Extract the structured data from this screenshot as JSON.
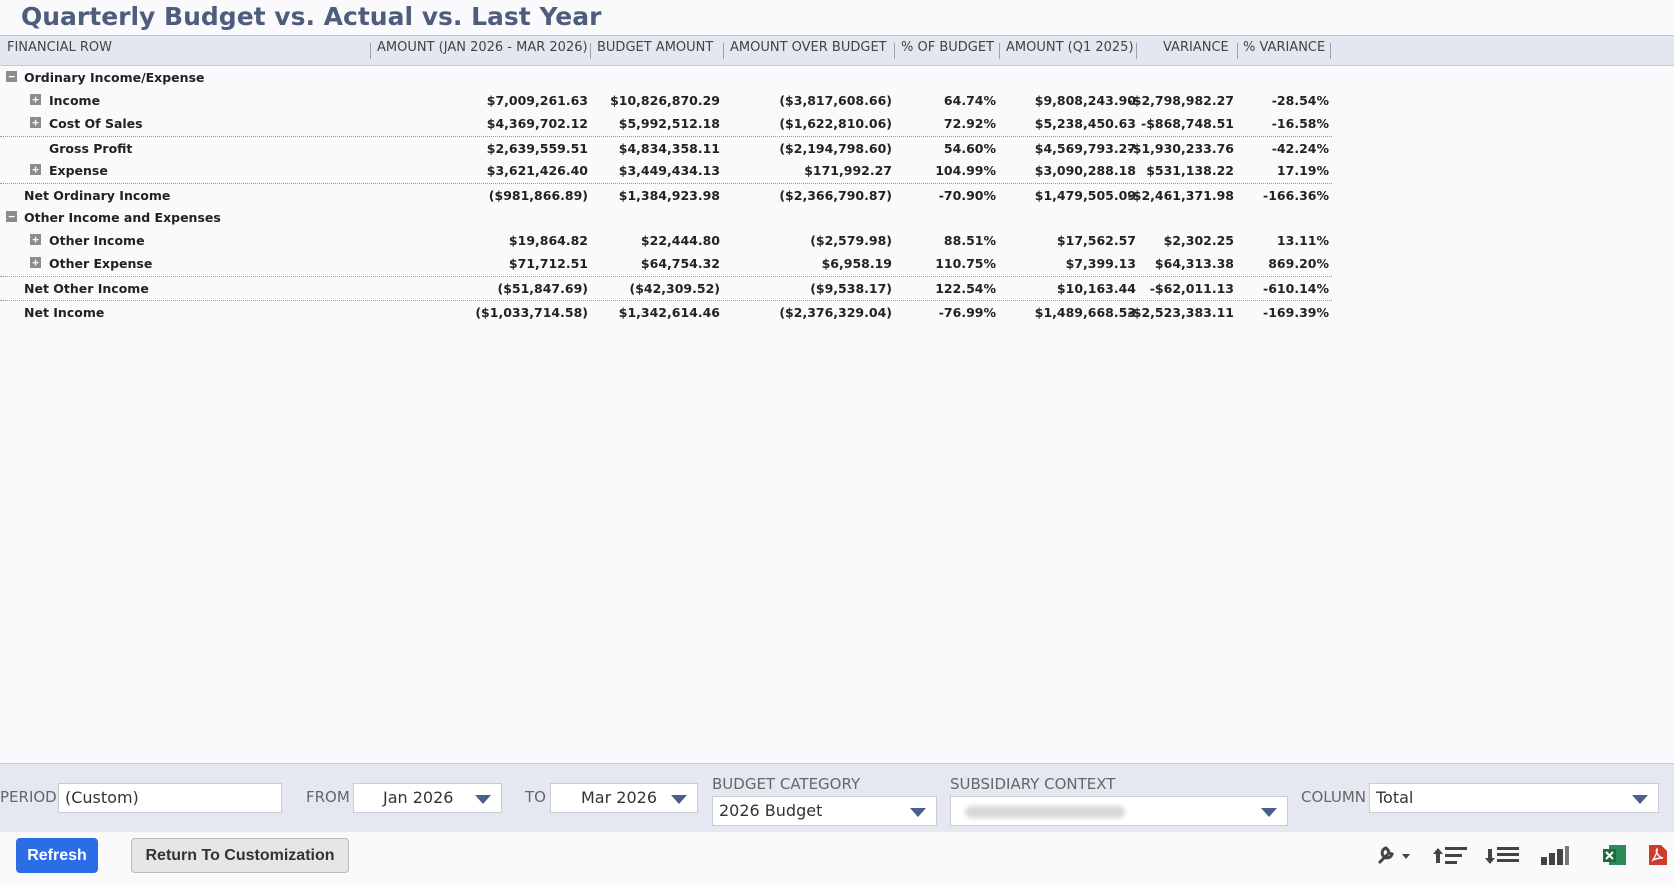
{
  "report": {
    "title": "Quarterly Budget vs. Actual vs. Last Year"
  },
  "columns": [
    "FINANCIAL ROW",
    "AMOUNT (JAN 2026 - MAR 2026)",
    "BUDGET AMOUNT",
    "AMOUNT OVER BUDGET",
    "% OF BUDGET",
    "AMOUNT (Q1 2025)",
    "VARIANCE",
    "% VARIANCE"
  ],
  "rows": [
    {
      "label": "Ordinary Income/Expense",
      "toggle": "minus",
      "values": [
        "",
        "",
        "",
        "",
        "",
        "",
        ""
      ]
    },
    {
      "label": "Income",
      "toggle": "plus",
      "values": [
        "$7,009,261.63",
        "$10,826,870.29",
        "($3,817,608.66)",
        "64.74%",
        "$9,808,243.90",
        "-$2,798,982.27",
        "-28.54%"
      ]
    },
    {
      "label": "Cost Of Sales",
      "toggle": "plus",
      "values": [
        "$4,369,702.12",
        "$5,992,512.18",
        "($1,622,810.06)",
        "72.92%",
        "$5,238,450.63",
        "-$868,748.51",
        "-16.58%"
      ]
    },
    {
      "label": "Gross Profit",
      "toggle": "",
      "values": [
        "$2,639,559.51",
        "$4,834,358.11",
        "($2,194,798.60)",
        "54.60%",
        "$4,569,793.27",
        "-$1,930,233.76",
        "-42.24%"
      ]
    },
    {
      "label": "Expense",
      "toggle": "plus",
      "values": [
        "$3,621,426.40",
        "$3,449,434.13",
        "$171,992.27",
        "104.99%",
        "$3,090,288.18",
        "$531,138.22",
        "17.19%"
      ]
    },
    {
      "label": "Net Ordinary Income",
      "toggle": "",
      "values": [
        "($981,866.89)",
        "$1,384,923.98",
        "($2,366,790.87)",
        "-70.90%",
        "$1,479,505.09",
        "-$2,461,371.98",
        "-166.36%"
      ]
    },
    {
      "label": "Other Income and Expenses",
      "toggle": "minus",
      "values": [
        "",
        "",
        "",
        "",
        "",
        "",
        ""
      ]
    },
    {
      "label": "Other Income",
      "toggle": "plus",
      "values": [
        "$19,864.82",
        "$22,444.80",
        "($2,579.98)",
        "88.51%",
        "$17,562.57",
        "$2,302.25",
        "13.11%"
      ]
    },
    {
      "label": "Other Expense",
      "toggle": "plus",
      "values": [
        "$71,712.51",
        "$64,754.32",
        "$6,958.19",
        "110.75%",
        "$7,399.13",
        "$64,313.38",
        "869.20%"
      ]
    },
    {
      "label": "Net Other Income",
      "toggle": "",
      "values": [
        "($51,847.69)",
        "($42,309.52)",
        "($9,538.17)",
        "122.54%",
        "$10,163.44",
        "-$62,011.13",
        "-610.14%"
      ]
    },
    {
      "label": "Net Income",
      "toggle": "",
      "values": [
        "($1,033,714.58)",
        "$1,342,614.46",
        "($2,376,329.04)",
        "-76.99%",
        "$1,489,668.53",
        "-$2,523,383.11",
        "-169.39%"
      ]
    }
  ],
  "filters": {
    "period_label": "PERIOD",
    "period_value": "(Custom)",
    "from_label": "FROM",
    "from_value": "Jan 2026",
    "to_label": "TO",
    "to_value": "Mar 2026",
    "budget_category_label": "BUDGET CATEGORY",
    "budget_category_value": "2026 Budget",
    "subsidiary_label": "SUBSIDIARY CONTEXT",
    "column_label": "COLUMN",
    "column_value": "Total"
  },
  "actions": {
    "refresh_label": "Refresh",
    "return_label": "Return To Customization"
  },
  "toolbar_icons": [
    "wrench-icon",
    "collapse-all-icon",
    "expand-all-icon",
    "chart-icon",
    "excel-export-icon",
    "pdf-export-icon"
  ],
  "colors": {
    "title": "#4f5d7c",
    "refresh_button": "#2a6de6",
    "header_background": "#e3e7f0",
    "excel_green": "#1f7a3e",
    "pdf_red": "#d23a2a"
  }
}
